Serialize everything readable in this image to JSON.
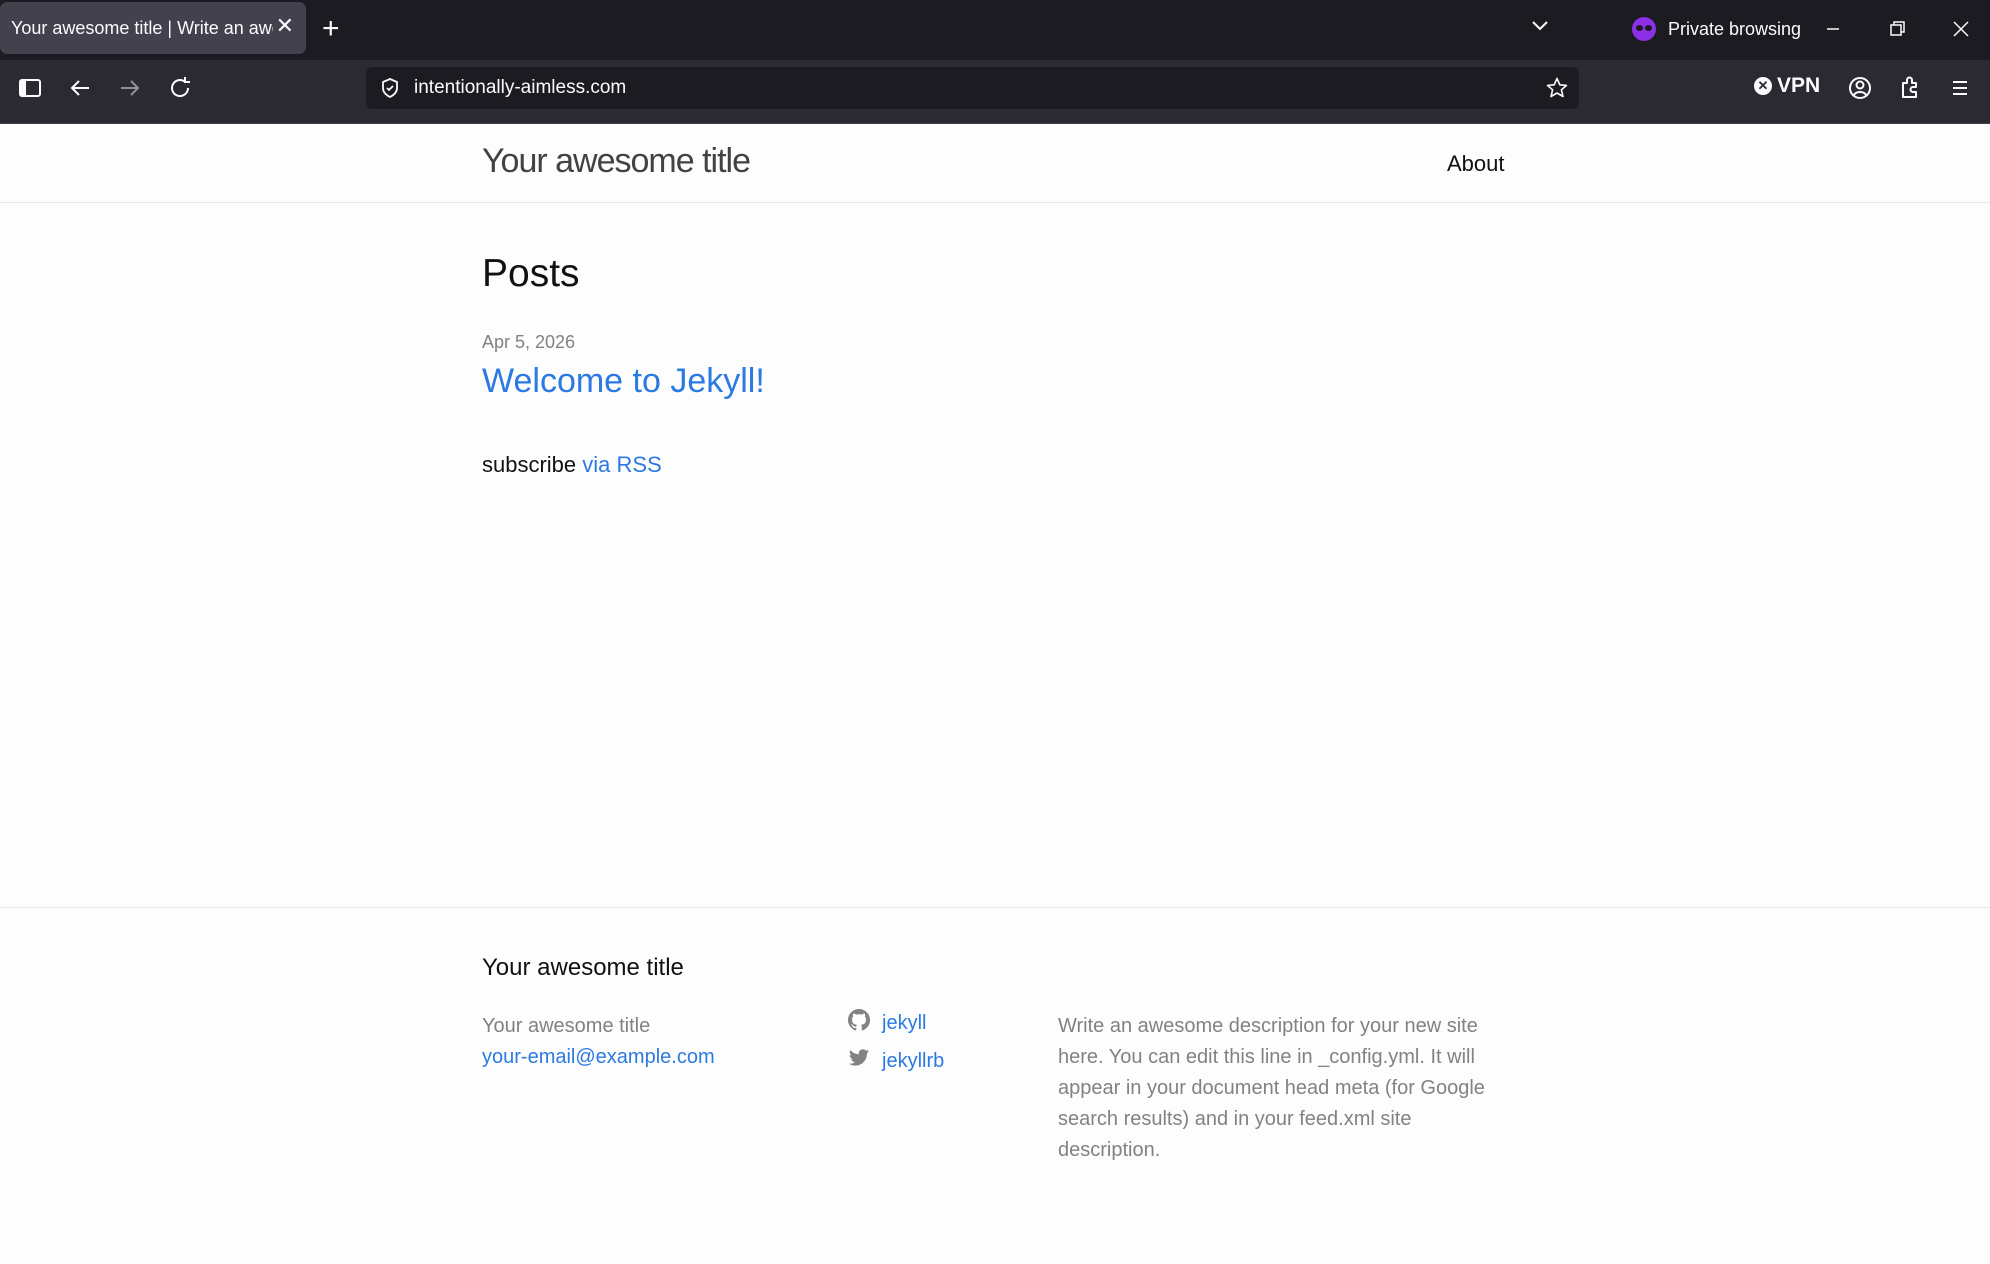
{
  "browser": {
    "tab_title": "Your awesome title | Write an awesome description",
    "private_label": "Private browsing",
    "url": "intentionally-aimless.com",
    "vpn_label": "VPN"
  },
  "site": {
    "title": "Your awesome title",
    "nav": [
      {
        "label": "About"
      }
    ]
  },
  "main": {
    "heading": "Posts",
    "posts": [
      {
        "date": "Apr 5, 2026",
        "title": "Welcome to Jekyll!"
      }
    ],
    "subscribe_text": "subscribe",
    "subscribe_link": "via RSS"
  },
  "footer": {
    "heading": "Your awesome title",
    "name": "Your awesome title",
    "email": "your-email@example.com",
    "social": [
      {
        "icon": "github-icon",
        "label": "jekyll"
      },
      {
        "icon": "twitter-icon",
        "label": "jekyllrb"
      }
    ],
    "description": "Write an awesome description for your new site here. You can edit this line in _config.yml. It will appear in your document head meta (for Google search results) and in your feed.xml site description."
  }
}
